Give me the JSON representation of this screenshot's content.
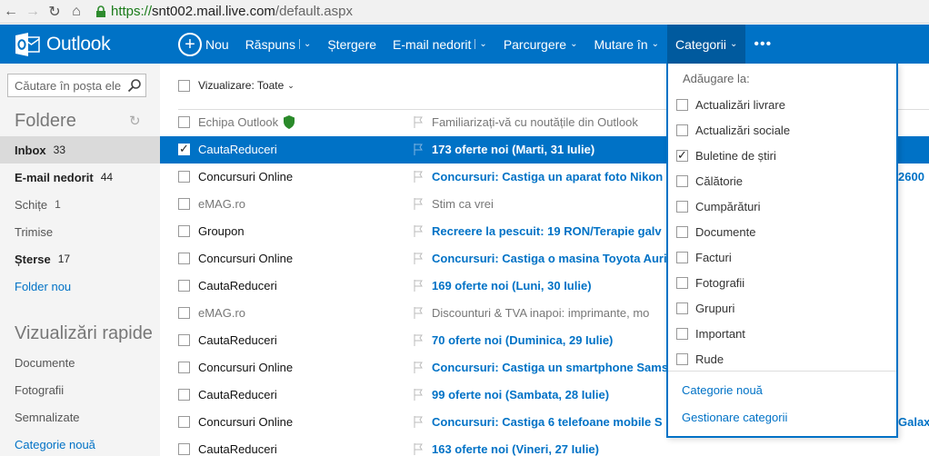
{
  "browser": {
    "url_scheme": "https://",
    "url_host": "snt002.mail.live.com",
    "url_path": "/default.aspx"
  },
  "app": {
    "logo_text": "Outlook",
    "brand_color": "#0072c6"
  },
  "toolbar": {
    "new_label": "Nou",
    "reply_label": "Răspuns",
    "delete_label": "Ștergere",
    "junk_label": "E-mail nedorit",
    "sweep_label": "Parcurgere",
    "move_label": "Mutare în",
    "categories_label": "Categorii",
    "more_label": "•••"
  },
  "sidebar": {
    "search_placeholder": "Căutare în poșta ele",
    "folders_title": "Foldere",
    "folders": [
      {
        "label": "Inbox",
        "count": "33"
      },
      {
        "label": "E-mail nedorit",
        "count": "44"
      },
      {
        "label": "Schițe",
        "count": "1"
      },
      {
        "label": "Trimise",
        "count": ""
      },
      {
        "label": "Șterse",
        "count": "17"
      }
    ],
    "new_folder": "Folder nou",
    "quickviews_title": "Vizualizări rapide",
    "quickviews": [
      "Documente",
      "Fotografii",
      "Semnalizate"
    ],
    "new_category": "Categorie nouă"
  },
  "list": {
    "filter_label": "Vizualizare: Toate",
    "rows": [
      {
        "sender": "Echipa Outlook",
        "subject": "Familiarizați-vă cu noutățile din Outlook"
      },
      {
        "sender": "CautaReduceri",
        "subject": "173 oferte noi (Marti, 31 Iulie)"
      },
      {
        "sender": "Concursuri Online",
        "subject": "Concursuri: Castiga un aparat foto Nikon"
      },
      {
        "sender": "eMAG.ro",
        "subject": "Stim ca vrei"
      },
      {
        "sender": "Groupon",
        "subject": "Recreere la pescuit: 19 RON/Terapie galv"
      },
      {
        "sender": "Concursuri Online",
        "subject": "Concursuri: Castiga o masina Toyota Auri"
      },
      {
        "sender": "CautaReduceri",
        "subject": "169 oferte noi (Luni, 30 Iulie)"
      },
      {
        "sender": "eMAG.ro",
        "subject": "Discounturi & TVA inapoi: imprimante, mo"
      },
      {
        "sender": "CautaReduceri",
        "subject": "70 oferte noi (Duminica, 29 Iulie)"
      },
      {
        "sender": "Concursuri Online",
        "subject": "Concursuri: Castiga un smartphone Sams"
      },
      {
        "sender": "CautaReduceri",
        "subject": "99 oferte noi (Sambata, 28 Iulie)"
      },
      {
        "sender": "Concursuri Online",
        "subject": "Concursuri: Castiga 6 telefoane mobile S"
      },
      {
        "sender": "CautaReduceri",
        "subject": "163 oferte noi (Vineri, 27 Iulie)"
      }
    ],
    "tail_row2": "2600",
    "tail_row11": "Galaxy"
  },
  "categories_menu": {
    "header": "Adăugare la:",
    "items": [
      "Actualizări livrare",
      "Actualizări sociale",
      "Buletine de știri",
      "Călătorie",
      "Cumpărături",
      "Documente",
      "Facturi",
      "Fotografii",
      "Grupuri",
      "Important",
      "Rude"
    ],
    "checked_item": "Buletine de știri",
    "new_category": "Categorie nouă",
    "manage_categories": "Gestionare categorii"
  }
}
